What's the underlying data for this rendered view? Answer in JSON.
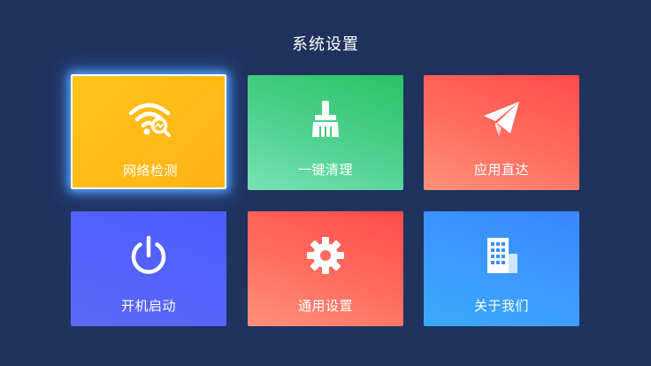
{
  "header": {
    "title": "系统设置"
  },
  "tiles": [
    {
      "label": "网络检测",
      "icon": "wifi-search-icon",
      "color": "#ffbb18",
      "selected": true
    },
    {
      "label": "一键清理",
      "icon": "broom-icon",
      "color": "#2ec46a"
    },
    {
      "label": "应用直达",
      "icon": "paper-plane-icon",
      "color": "#ff5a52"
    },
    {
      "label": "开机启动",
      "icon": "power-icon",
      "color": "#5561fb"
    },
    {
      "label": "通用设置",
      "icon": "gear-icon",
      "color": "#ff5a52"
    },
    {
      "label": "关于我们",
      "icon": "building-icon",
      "color": "#3a94ff"
    }
  ],
  "colors": {
    "background": "#20325e",
    "focus_glow": "#5aaaff"
  }
}
